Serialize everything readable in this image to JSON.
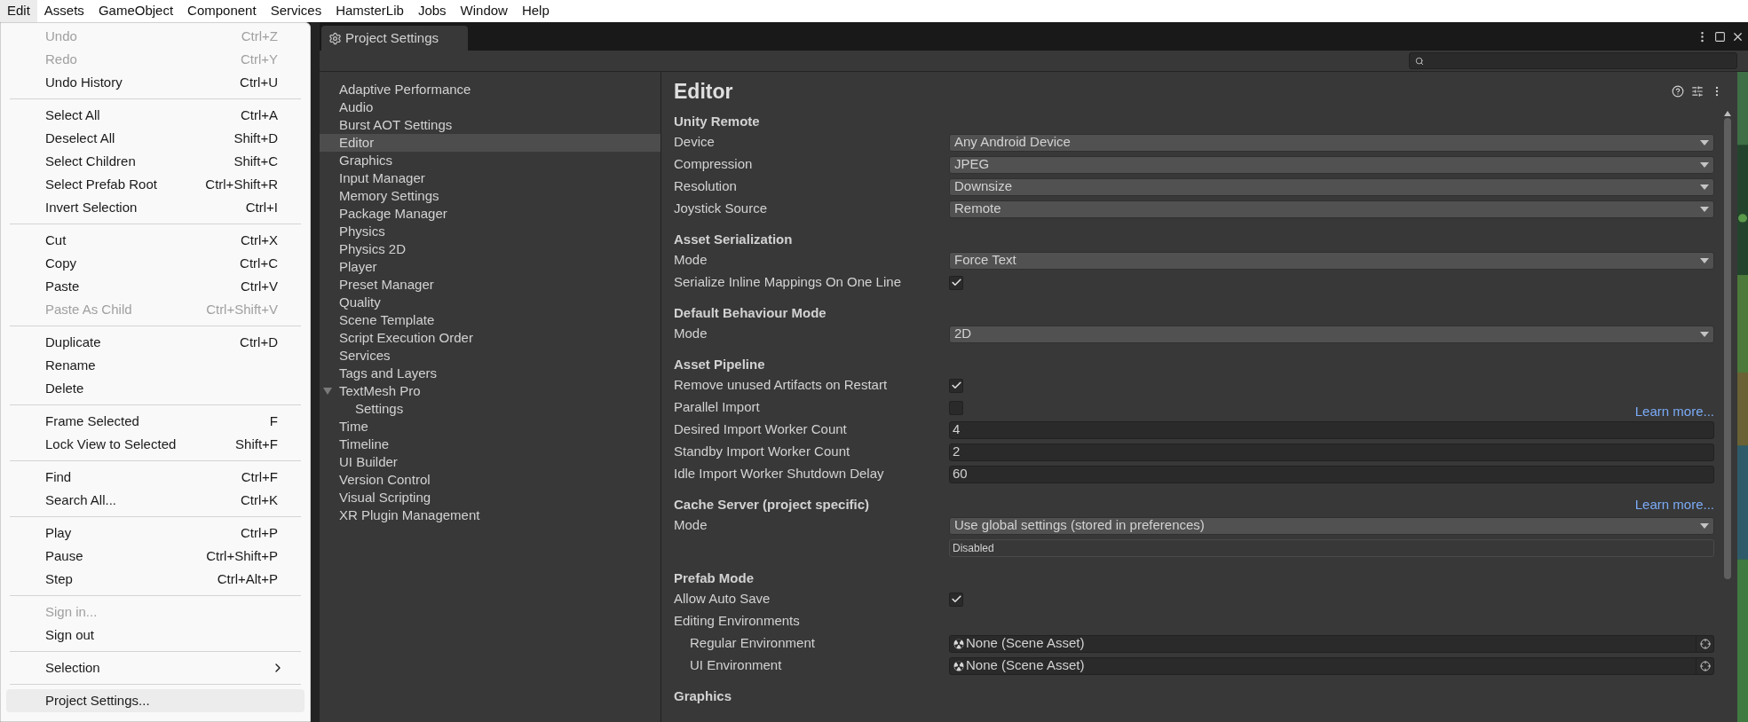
{
  "menubar": [
    {
      "label": "Edit",
      "selected": true
    },
    {
      "label": "Assets",
      "selected": false
    },
    {
      "label": "GameObject",
      "selected": false
    },
    {
      "label": "Component",
      "selected": false
    },
    {
      "label": "Services",
      "selected": false
    },
    {
      "label": "HamsterLib",
      "selected": false
    },
    {
      "label": "Jobs",
      "selected": false
    },
    {
      "label": "Window",
      "selected": false
    },
    {
      "label": "Help",
      "selected": false
    }
  ],
  "edit_menu": [
    [
      {
        "label": "Undo",
        "shortcut": "Ctrl+Z",
        "disabled": true,
        "selected": false
      },
      {
        "label": "Redo",
        "shortcut": "Ctrl+Y",
        "disabled": true,
        "selected": false
      },
      {
        "label": "Undo History",
        "shortcut": "Ctrl+U",
        "disabled": false,
        "selected": false
      }
    ],
    [
      {
        "label": "Select All",
        "shortcut": "Ctrl+A",
        "disabled": false,
        "selected": false
      },
      {
        "label": "Deselect All",
        "shortcut": "Shift+D",
        "disabled": false,
        "selected": false
      },
      {
        "label": "Select Children",
        "shortcut": "Shift+C",
        "disabled": false,
        "selected": false
      },
      {
        "label": "Select Prefab Root",
        "shortcut": "Ctrl+Shift+R",
        "disabled": false,
        "selected": false
      },
      {
        "label": "Invert Selection",
        "shortcut": "Ctrl+I",
        "disabled": false,
        "selected": false
      }
    ],
    [
      {
        "label": "Cut",
        "shortcut": "Ctrl+X",
        "disabled": false,
        "selected": false
      },
      {
        "label": "Copy",
        "shortcut": "Ctrl+C",
        "disabled": false,
        "selected": false
      },
      {
        "label": "Paste",
        "shortcut": "Ctrl+V",
        "disabled": false,
        "selected": false
      },
      {
        "label": "Paste As Child",
        "shortcut": "Ctrl+Shift+V",
        "disabled": true,
        "selected": false
      }
    ],
    [
      {
        "label": "Duplicate",
        "shortcut": "Ctrl+D",
        "disabled": false,
        "selected": false
      },
      {
        "label": "Rename",
        "disabled": false,
        "selected": false
      },
      {
        "label": "Delete",
        "disabled": false,
        "selected": false
      }
    ],
    [
      {
        "label": "Frame Selected",
        "shortcut": "F",
        "disabled": false,
        "selected": false
      },
      {
        "label": "Lock View to Selected",
        "shortcut": "Shift+F",
        "disabled": false,
        "selected": false
      }
    ],
    [
      {
        "label": "Find",
        "shortcut": "Ctrl+F",
        "disabled": false,
        "selected": false
      },
      {
        "label": "Search All...",
        "shortcut": "Ctrl+K",
        "disabled": false,
        "selected": false
      }
    ],
    [
      {
        "label": "Play",
        "shortcut": "Ctrl+P",
        "disabled": false,
        "selected": false
      },
      {
        "label": "Pause",
        "shortcut": "Ctrl+Shift+P",
        "disabled": false,
        "selected": false
      },
      {
        "label": "Step",
        "shortcut": "Ctrl+Alt+P",
        "disabled": false,
        "selected": false
      }
    ],
    [
      {
        "label": "Sign in...",
        "disabled": true,
        "selected": false
      },
      {
        "label": "Sign out",
        "disabled": false,
        "selected": false
      }
    ],
    [
      {
        "label": "Selection",
        "disabled": false,
        "selected": false,
        "submenu": true
      }
    ],
    [
      {
        "label": "Project Settings...",
        "disabled": false,
        "selected": true
      }
    ]
  ],
  "window": {
    "title": "Project Settings",
    "sidebar": [
      {
        "label": "Adaptive Performance",
        "selected": false
      },
      {
        "label": "Audio",
        "selected": false
      },
      {
        "label": "Burst AOT Settings",
        "selected": false
      },
      {
        "label": "Editor",
        "selected": true
      },
      {
        "label": "Graphics",
        "selected": false
      },
      {
        "label": "Input Manager",
        "selected": false
      },
      {
        "label": "Memory Settings",
        "selected": false
      },
      {
        "label": "Package Manager",
        "selected": false
      },
      {
        "label": "Physics",
        "selected": false
      },
      {
        "label": "Physics 2D",
        "selected": false
      },
      {
        "label": "Player",
        "selected": false
      },
      {
        "label": "Preset Manager",
        "selected": false
      },
      {
        "label": "Quality",
        "selected": false
      },
      {
        "label": "Scene Template",
        "selected": false
      },
      {
        "label": "Script Execution Order",
        "selected": false
      },
      {
        "label": "Services",
        "selected": false
      },
      {
        "label": "Tags and Layers",
        "selected": false
      },
      {
        "label": "TextMesh Pro",
        "selected": false,
        "expanded": true,
        "children": [
          {
            "label": "Settings",
            "selected": false
          }
        ]
      },
      {
        "label": "Time",
        "selected": false
      },
      {
        "label": "Timeline",
        "selected": false
      },
      {
        "label": "UI Builder",
        "selected": false
      },
      {
        "label": "Version Control",
        "selected": false
      },
      {
        "label": "Visual Scripting",
        "selected": false
      },
      {
        "label": "XR Plugin Management",
        "selected": false
      }
    ],
    "content": {
      "title": "Editor",
      "sections": [
        {
          "heading": "Unity Remote",
          "rows": [
            {
              "kind": "dropdown",
              "label": "Device",
              "value": "Any Android Device"
            },
            {
              "kind": "dropdown",
              "label": "Compression",
              "value": "JPEG"
            },
            {
              "kind": "dropdown",
              "label": "Resolution",
              "value": "Downsize"
            },
            {
              "kind": "dropdown",
              "label": "Joystick Source",
              "value": "Remote"
            }
          ]
        },
        {
          "heading": "Asset Serialization",
          "rows": [
            {
              "kind": "dropdown",
              "label": "Mode",
              "value": "Force Text"
            },
            {
              "kind": "checkbox",
              "label": "Serialize Inline Mappings On One Line",
              "checked": true
            }
          ]
        },
        {
          "heading": "Default Behaviour Mode",
          "rows": [
            {
              "kind": "dropdown",
              "label": "Mode",
              "value": "2D"
            }
          ]
        },
        {
          "heading": "Asset Pipeline",
          "rows": [
            {
              "kind": "checkbox",
              "label": "Remove unused Artifacts on Restart",
              "checked": true
            },
            {
              "kind": "checkbox",
              "label": "Parallel Import",
              "checked": false,
              "link": "Learn more..."
            },
            {
              "kind": "number",
              "label": "Desired Import Worker Count",
              "value": "4"
            },
            {
              "kind": "number",
              "label": "Standby Import Worker Count",
              "value": "2"
            },
            {
              "kind": "number",
              "label": "Idle Import Worker Shutdown Delay",
              "value": "60"
            }
          ]
        },
        {
          "heading": "Cache Server (project specific)",
          "link": "Learn more...",
          "rows": [
            {
              "kind": "dropdown",
              "label": "Mode",
              "value": "Use global settings (stored in preferences)"
            },
            {
              "kind": "note",
              "value": "Disabled"
            }
          ]
        },
        {
          "heading": "Prefab Mode",
          "rows": [
            {
              "kind": "checkbox",
              "label": "Allow Auto Save",
              "checked": true
            },
            {
              "kind": "group",
              "label": "Editing Environments",
              "children": [
                {
                  "kind": "object",
                  "label": "Regular Environment",
                  "value": "None (Scene Asset)"
                },
                {
                  "kind": "object",
                  "label": "UI Environment",
                  "value": "None (Scene Asset)"
                }
              ]
            }
          ]
        },
        {
          "heading": "Graphics"
        }
      ]
    }
  }
}
